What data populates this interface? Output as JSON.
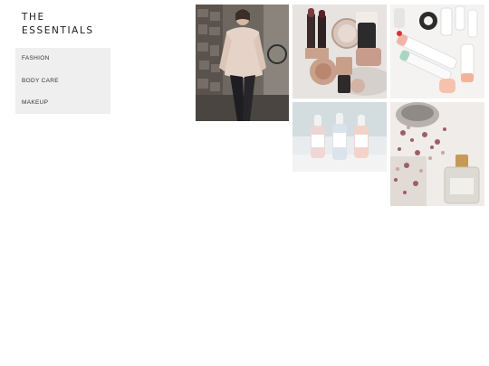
{
  "brand": {
    "line1": "THE",
    "line2": "ESSENTIALS"
  },
  "nav": {
    "items": [
      {
        "label": "FASHION"
      },
      {
        "label": "BODY CARE"
      },
      {
        "label": "MAKEUP"
      }
    ]
  },
  "gallery": {
    "images": [
      {
        "name": "fashion-photo",
        "subject": "woman in beige sweater leaning on stone wall"
      },
      {
        "name": "makeup-photo",
        "subject": "lipsticks and compacts on marble"
      },
      {
        "name": "skincare-tubes-photo",
        "subject": "skincare tubes on white surface"
      },
      {
        "name": "serum-bottles-photo",
        "subject": "three dropper serum bottles"
      },
      {
        "name": "bath-oil-photo",
        "subject": "bath oil bottle with dried petals"
      }
    ]
  },
  "colors": {
    "nav_bg": "#efefef",
    "text": "#1a1a1a",
    "accent_pink": "#e8b8b0"
  }
}
